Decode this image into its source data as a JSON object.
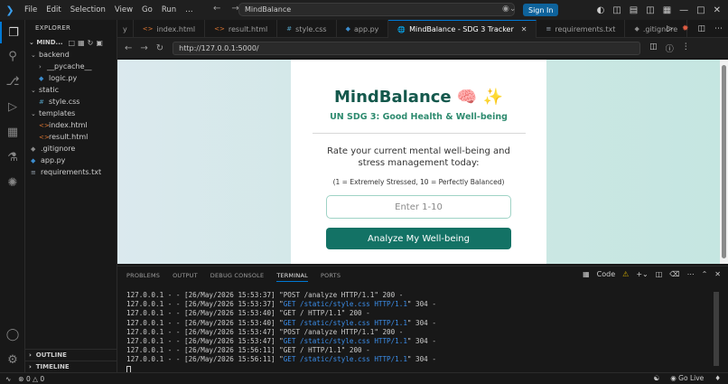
{
  "titlebar": {
    "menu": [
      "File",
      "Edit",
      "Selection",
      "View",
      "Go",
      "Run",
      "…"
    ],
    "search": "MindBalance",
    "signin": "Sign In"
  },
  "explorer": {
    "title": "EXPLORER",
    "project": "MIND...",
    "tree": [
      {
        "label": "backend",
        "kind": "folder",
        "indent": 0,
        "open": true
      },
      {
        "label": "__pycache__",
        "kind": "folder",
        "indent": 1,
        "open": false
      },
      {
        "label": "logic.py",
        "kind": "py",
        "indent": 1
      },
      {
        "label": "static",
        "kind": "folder",
        "indent": 0,
        "open": true
      },
      {
        "label": "style.css",
        "kind": "css",
        "indent": 1
      },
      {
        "label": "templates",
        "kind": "folder",
        "indent": 0,
        "open": true
      },
      {
        "label": "index.html",
        "kind": "html",
        "indent": 1
      },
      {
        "label": "result.html",
        "kind": "html",
        "indent": 1
      },
      {
        "label": ".gitignore",
        "kind": "git",
        "indent": 0
      },
      {
        "label": "app.py",
        "kind": "py",
        "indent": 0
      },
      {
        "label": "requirements.txt",
        "kind": "txt",
        "indent": 0
      }
    ],
    "outline": "OUTLINE",
    "timeline": "TIMELINE"
  },
  "tabs": [
    {
      "label": "index.html",
      "kind": "html"
    },
    {
      "label": "result.html",
      "kind": "html"
    },
    {
      "label": "style.css",
      "kind": "css"
    },
    {
      "label": "app.py",
      "kind": "py"
    },
    {
      "label": "MindBalance - SDG 3 Tracker",
      "kind": "globe",
      "active": true
    },
    {
      "label": "requirements.txt",
      "kind": "txt"
    },
    {
      "label": ".gitignore",
      "kind": "git"
    }
  ],
  "browser": {
    "url": "http://127.0.0.1:5000/"
  },
  "page": {
    "title": "MindBalance 🧠 ✨",
    "subtitle": "UN SDG 3: Good Health & Well-being",
    "question": "Rate your current mental well-being and stress management today:",
    "scale": "(1 = Extremely Stressed, 10 = Perfectly Balanced)",
    "input_placeholder": "Enter 1-10",
    "button": "Analyze My Well-being"
  },
  "panel": {
    "tabs": [
      "PROBLEMS",
      "OUTPUT",
      "DEBUG CONSOLE",
      "TERMINAL",
      "PORTS"
    ],
    "active_tab": "TERMINAL",
    "terminal_name": "Code",
    "log": [
      {
        "pre": "127.0.0.1 - - [26/May/2026 15:53:37] \"",
        "req": "POST /analyze HTTP/1.1",
        "hl": false,
        "post": "\" 200 -"
      },
      {
        "pre": "127.0.0.1 - - [26/May/2026 15:53:37] \"",
        "req": "GET /static/style.css HTTP/1.1",
        "hl": true,
        "post": "\" 304 -"
      },
      {
        "pre": "127.0.0.1 - - [26/May/2026 15:53:40] \"",
        "req": "GET / HTTP/1.1",
        "hl": false,
        "post": "\" 200 -"
      },
      {
        "pre": "127.0.0.1 - - [26/May/2026 15:53:40] \"",
        "req": "GET /static/style.css HTTP/1.1",
        "hl": true,
        "post": "\" 304 -"
      },
      {
        "pre": "127.0.0.1 - - [26/May/2026 15:53:47] \"",
        "req": "POST /analyze HTTP/1.1",
        "hl": false,
        "post": "\" 200 -"
      },
      {
        "pre": "127.0.0.1 - - [26/May/2026 15:53:47] \"",
        "req": "GET /static/style.css HTTP/1.1",
        "hl": true,
        "post": "\" 304 -"
      },
      {
        "pre": "127.0.0.1 - - [26/May/2026 15:56:11] \"",
        "req": "GET / HTTP/1.1",
        "hl": false,
        "post": "\" 200 -"
      },
      {
        "pre": "127.0.0.1 - - [26/May/2026 15:56:11] \"",
        "req": "GET /static/style.css HTTP/1.1",
        "hl": true,
        "post": "\" 304 -"
      }
    ]
  },
  "status": {
    "errors": "0",
    "warnings": "0",
    "golive": "Go Live"
  },
  "colors": {
    "accent": "#0078d4",
    "button": "#137265",
    "title": "#14584c",
    "subtitle": "#2e8b6f",
    "link": "#3b8eea"
  }
}
